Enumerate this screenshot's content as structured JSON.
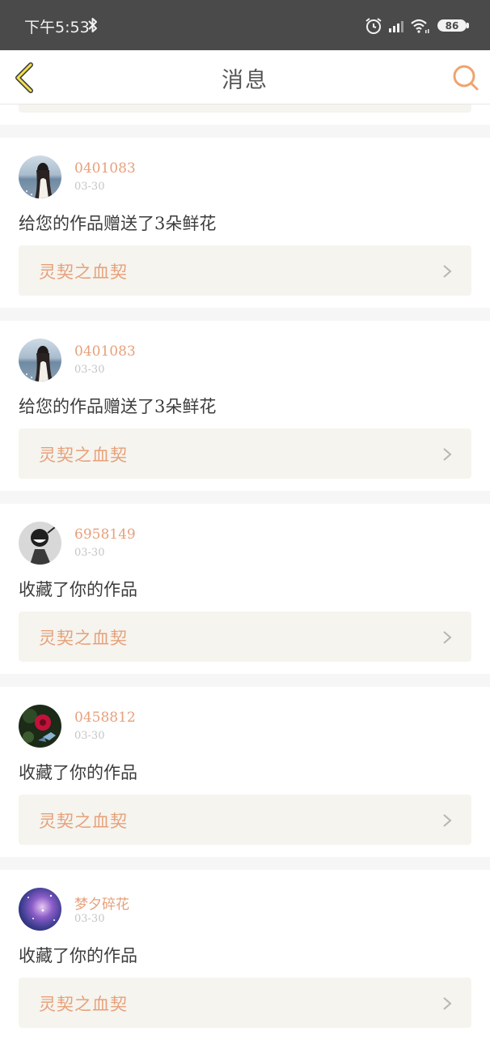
{
  "status_bar": {
    "time": "下午5:53",
    "battery": "86"
  },
  "header": {
    "title": "消息",
    "back_icon": "chevron-left-icon",
    "search_icon": "search-icon"
  },
  "colors": {
    "accent": "#e7a07a",
    "status_bar_bg": "#4a4a4a",
    "card_bg": "#ffffff",
    "work_box_bg": "#f5f4ee"
  },
  "messages": [
    {
      "username": "0401083",
      "date": "03-30",
      "action": "给您的作品赠送了3朵鲜花",
      "work_title": "灵契之血契",
      "avatar": "girl-sea-photo"
    },
    {
      "username": "0401083",
      "date": "03-30",
      "action": "给您的作品赠送了3朵鲜花",
      "work_title": "灵契之血契",
      "avatar": "girl-sea-photo"
    },
    {
      "username": "6958149",
      "date": "03-30",
      "action": "收藏了你的作品",
      "work_title": "灵契之血契",
      "avatar": "anime-sketch"
    },
    {
      "username": "0458812",
      "date": "03-30",
      "action": "收藏了你的作品",
      "work_title": "灵契之血契",
      "avatar": "flower-butterfly"
    },
    {
      "username": "梦夕碎花",
      "date": "03-30",
      "action": "收藏了你的作品",
      "work_title": "灵契之血契",
      "avatar": "galaxy"
    }
  ]
}
